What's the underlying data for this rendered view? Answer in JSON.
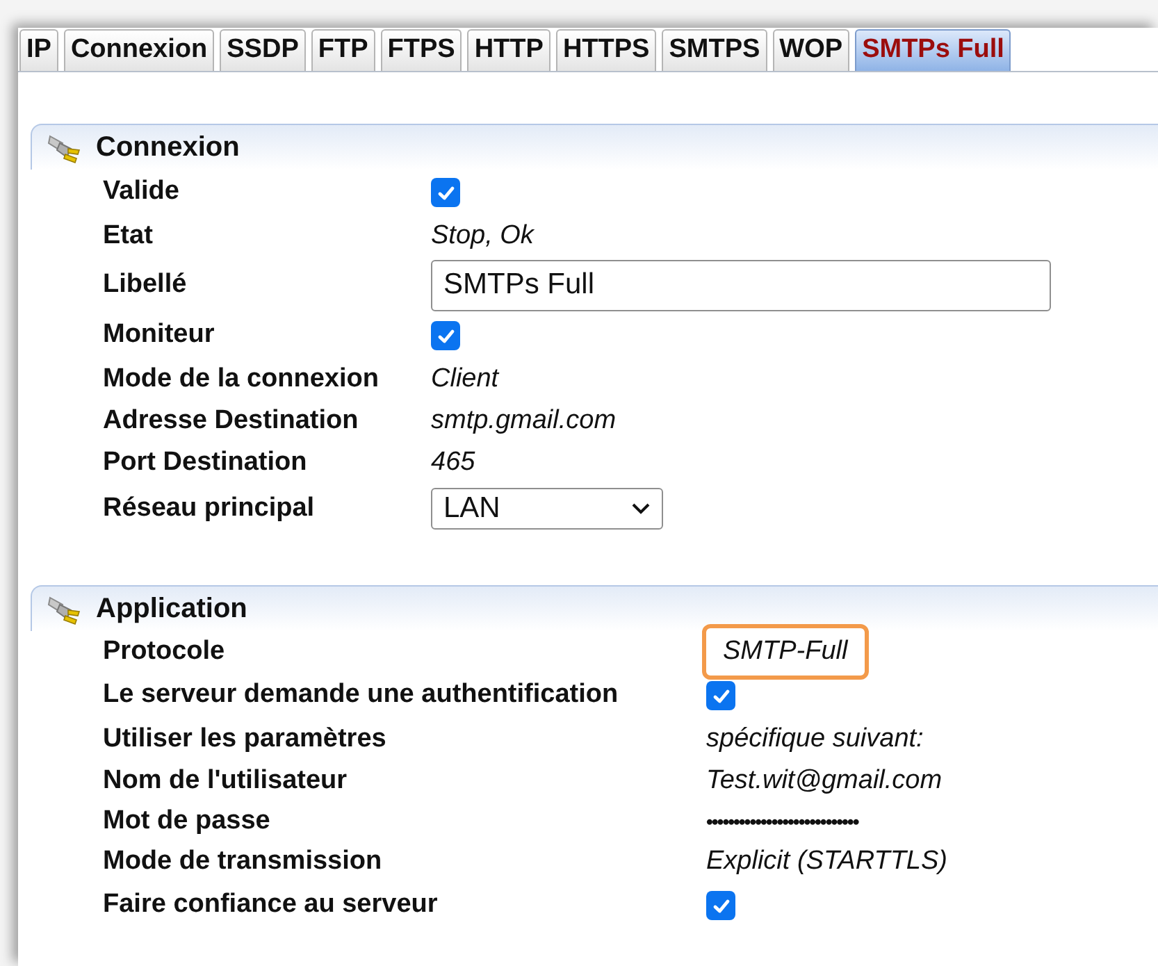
{
  "tabs": [
    {
      "label": "IP",
      "selected": false
    },
    {
      "label": "Connexion",
      "selected": false
    },
    {
      "label": "SSDP",
      "selected": false
    },
    {
      "label": "FTP",
      "selected": false
    },
    {
      "label": "FTPS",
      "selected": false
    },
    {
      "label": "HTTP",
      "selected": false
    },
    {
      "label": "HTTPS",
      "selected": false
    },
    {
      "label": "SMTPS",
      "selected": false
    },
    {
      "label": "WOP",
      "selected": false
    },
    {
      "label": "SMTPs Full",
      "selected": true
    }
  ],
  "sections": [
    {
      "title": "Connexion",
      "rows": [
        {
          "kind": "checkbox",
          "label": "Valide",
          "checked": true
        },
        {
          "kind": "text",
          "label": "Etat",
          "value": "Stop, Ok"
        },
        {
          "kind": "input",
          "label": "Libellé",
          "value": "SMTPs Full"
        },
        {
          "kind": "checkbox",
          "label": "Moniteur",
          "checked": true
        },
        {
          "kind": "text",
          "label": "Mode de la connexion",
          "value": "Client"
        },
        {
          "kind": "text",
          "label": "Adresse Destination",
          "value": "smtp.gmail.com"
        },
        {
          "kind": "text",
          "label": "Port Destination",
          "value": "465"
        },
        {
          "kind": "select",
          "label": "Réseau principal",
          "value": "LAN"
        }
      ]
    },
    {
      "title": "Application",
      "rows": [
        {
          "kind": "text",
          "label": "Protocole",
          "value": "SMTP-Full",
          "highlighted": true
        },
        {
          "kind": "checkbox",
          "label": "Le serveur demande une authentification",
          "checked": true
        },
        {
          "kind": "text",
          "label": "Utiliser les paramètres",
          "value": "spécifique suivant:"
        },
        {
          "kind": "text",
          "label": "Nom de l'utilisateur",
          "value": "Test.wit@gmail.com"
        },
        {
          "kind": "password",
          "label": "Mot de passe",
          "value": "••••••••••••••••••••••••••••"
        },
        {
          "kind": "text",
          "label": "Mode de transmission",
          "value": "Explicit (STARTTLS)"
        },
        {
          "kind": "checkbox",
          "label": "Faire confiance au serveur",
          "checked": true
        }
      ]
    }
  ]
}
